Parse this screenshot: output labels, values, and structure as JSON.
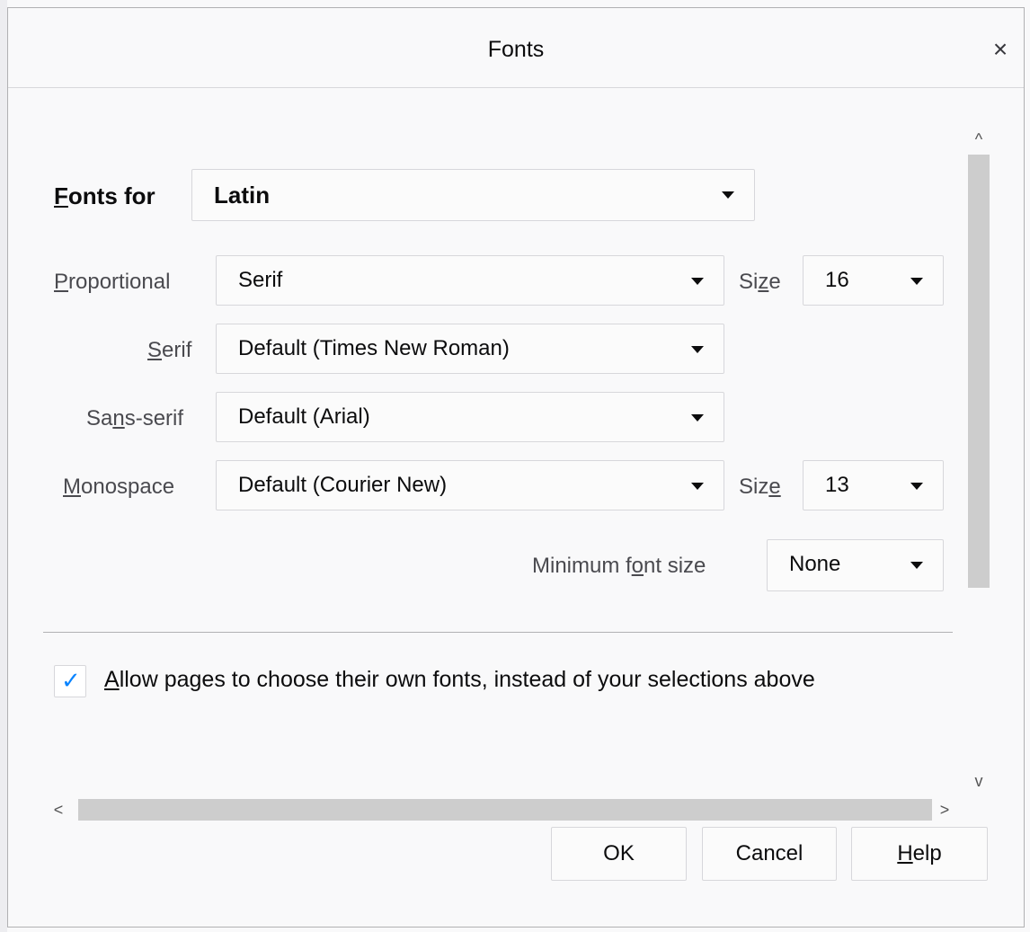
{
  "dialog": {
    "title": "Fonts",
    "close_glyph": "×"
  },
  "fonts_for": {
    "label_first": "F",
    "label_rest": "onts for",
    "value": "Latin"
  },
  "proportional": {
    "label_first": "P",
    "label_rest": "roportional",
    "value": "Serif",
    "size_label_a": "Si",
    "size_label_u": "z",
    "size_label_b": "e",
    "size_value": "16"
  },
  "serif": {
    "label_first": "S",
    "label_rest": "erif",
    "value": "Default (Times New Roman)"
  },
  "sans_serif": {
    "label_a": "Sa",
    "label_u": "n",
    "label_b": "s-serif",
    "value": "Default (Arial)"
  },
  "monospace": {
    "label_first": "M",
    "label_rest": "onospace",
    "value": "Default (Courier New)",
    "size_label_a": "Siz",
    "size_label_u": "e",
    "size_value": "13"
  },
  "minimum": {
    "label_a": "Minimum f",
    "label_u": "o",
    "label_b": "nt size",
    "value": "None"
  },
  "allow_pages": {
    "label_first": "A",
    "label_rest": "llow pages to choose their own fonts, instead of your selections above",
    "checked": true
  },
  "scrollbars": {
    "up": "^",
    "down": "v",
    "left": "<",
    "right": ">"
  },
  "buttons": {
    "ok": "OK",
    "cancel": "Cancel",
    "help_first": "H",
    "help_rest": "elp"
  }
}
